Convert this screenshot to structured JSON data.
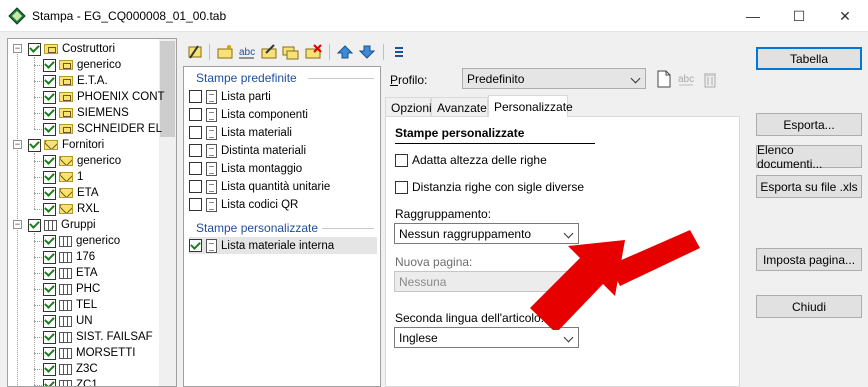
{
  "window": {
    "title": "Stampa - EG_CQ000008_01_00.tab",
    "minimize_glyph": "—",
    "maximize_glyph": "☐",
    "close_glyph": "✕"
  },
  "tree": {
    "groups": [
      {
        "label": "Costruttori",
        "icon": "folder-icon",
        "children": [
          "generico",
          "E.T.A.",
          "PHOENIX CONT",
          "SIEMENS",
          "SCHNEIDER EL"
        ]
      },
      {
        "label": "Fornitori",
        "icon": "envelope-icon",
        "children": [
          "generico",
          "1",
          "ETA",
          "RXL"
        ]
      },
      {
        "label": "Gruppi",
        "icon": "grid-icon",
        "children": [
          "generico",
          "176",
          "ETA",
          "PHC",
          "TEL",
          "UN",
          "SIST. FAILSAF",
          "MORSETTI",
          "Z3C",
          "ZC1"
        ]
      }
    ]
  },
  "reports": {
    "predefined_title": "Stampe predefinite",
    "predefined": [
      "Lista parti",
      "Lista componenti",
      "Lista materiali",
      "Distinta materiali",
      "Lista montaggio",
      "Lista quantità unitarie",
      "Lista codici QR"
    ],
    "custom_title": "Stampe personalizzate",
    "custom": [
      {
        "label": "Lista materiale interna",
        "checked": true
      }
    ]
  },
  "profile": {
    "label": "Profilo:",
    "value": "Predefinito"
  },
  "tabs": [
    "Opzioni",
    "Avanzate",
    "Personalizzate"
  ],
  "active_tab": "Personalizzate",
  "panel": {
    "title": "Stampe personalizzate",
    "opt_adapt": "Adatta altezza delle righe",
    "opt_distance": "Distanzia righe con sigle diverse",
    "grouping_label": "Raggruppamento:",
    "grouping_value": "Nessun raggruppamento",
    "newpage_label": "Nuova pagina:",
    "newpage_value": "Nessuna",
    "language_label": "Seconda lingua dell'articolo:",
    "language_value": "Inglese"
  },
  "buttons": {
    "table": "Tabella",
    "export": "Esporta...",
    "doc_list": "Elenco documenti...",
    "export_xls": "Esporta su file .xls",
    "page_setup": "Imposta pagina...",
    "close": "Chiudi"
  },
  "colors": {
    "accent": "#0078d7",
    "group_title": "#1e4e9e",
    "annotation_arrow": "#e60000"
  }
}
